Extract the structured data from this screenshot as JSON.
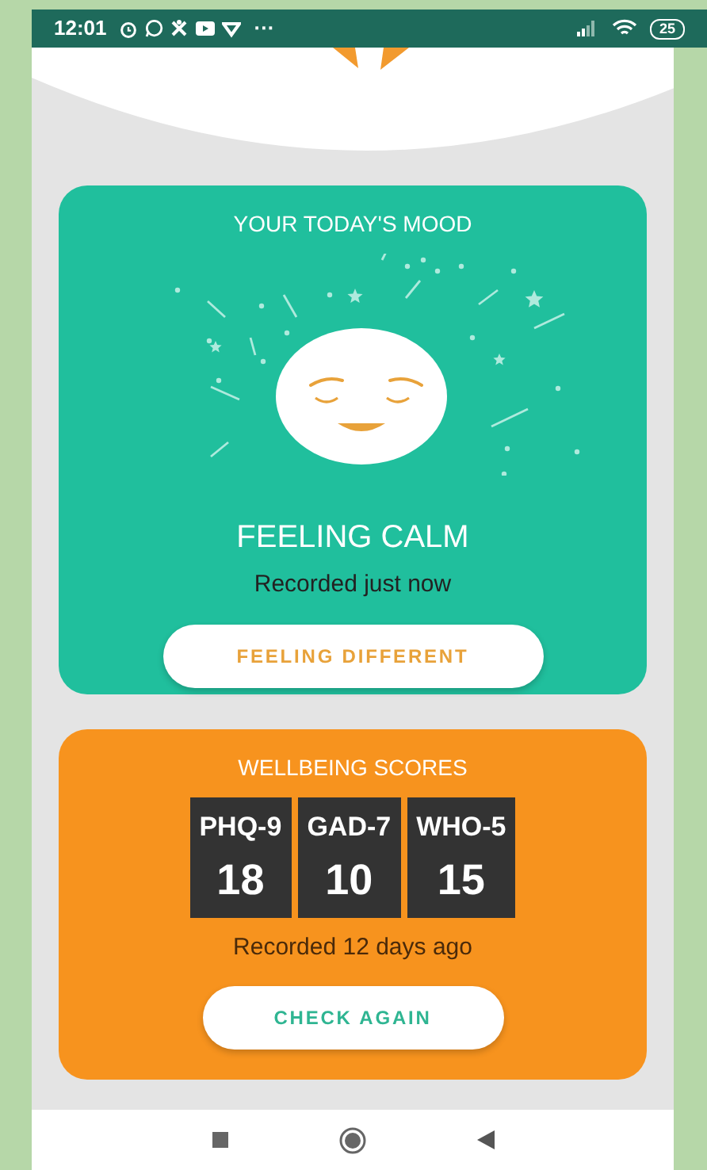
{
  "status_bar": {
    "time": "12:01",
    "more": "···",
    "battery": "25"
  },
  "mood_card": {
    "title": "YOUR TODAY'S MOOD",
    "mood": "FEELING CALM",
    "recorded": "Recorded just now",
    "button": "FEELING DIFFERENT"
  },
  "scores_card": {
    "title": "WELLBEING SCORES",
    "scores": [
      {
        "name": "PHQ-9",
        "value": "18"
      },
      {
        "name": "GAD-7",
        "value": "10"
      },
      {
        "name": "WHO-5",
        "value": "15"
      }
    ],
    "recorded": "Recorded 12 days ago",
    "button": "CHECK AGAIN"
  }
}
